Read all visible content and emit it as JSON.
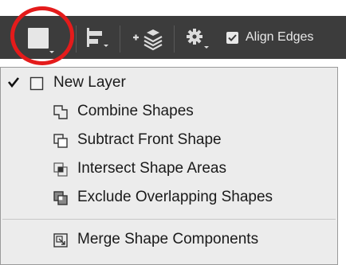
{
  "toolbar": {
    "align_edges_label": "Align Edges",
    "align_edges_checked": true,
    "path_operations_button": "square-shape-icon",
    "path_alignment_button": "align-left-icon",
    "path_arrangement_button": "arrange-layers-icon",
    "settings_button": "gear-icon"
  },
  "menu": {
    "items": [
      {
        "label": "New Layer",
        "icon": "new-layer-icon",
        "checked": true
      },
      {
        "label": "Combine Shapes",
        "icon": "combine-shapes-icon",
        "checked": false
      },
      {
        "label": "Subtract Front Shape",
        "icon": "subtract-front-shape-icon",
        "checked": false
      },
      {
        "label": "Intersect Shape Areas",
        "icon": "intersect-shape-areas-icon",
        "checked": false
      },
      {
        "label": "Exclude Overlapping Shapes",
        "icon": "exclude-overlapping-shapes-icon",
        "checked": false
      },
      {
        "label": "Merge Shape Components",
        "icon": "merge-shape-components-icon",
        "checked": false
      }
    ]
  },
  "colors": {
    "toolbar_bg": "#3c3c3c",
    "menu_bg": "#ececec",
    "highlight_ring": "#e41b1b"
  }
}
